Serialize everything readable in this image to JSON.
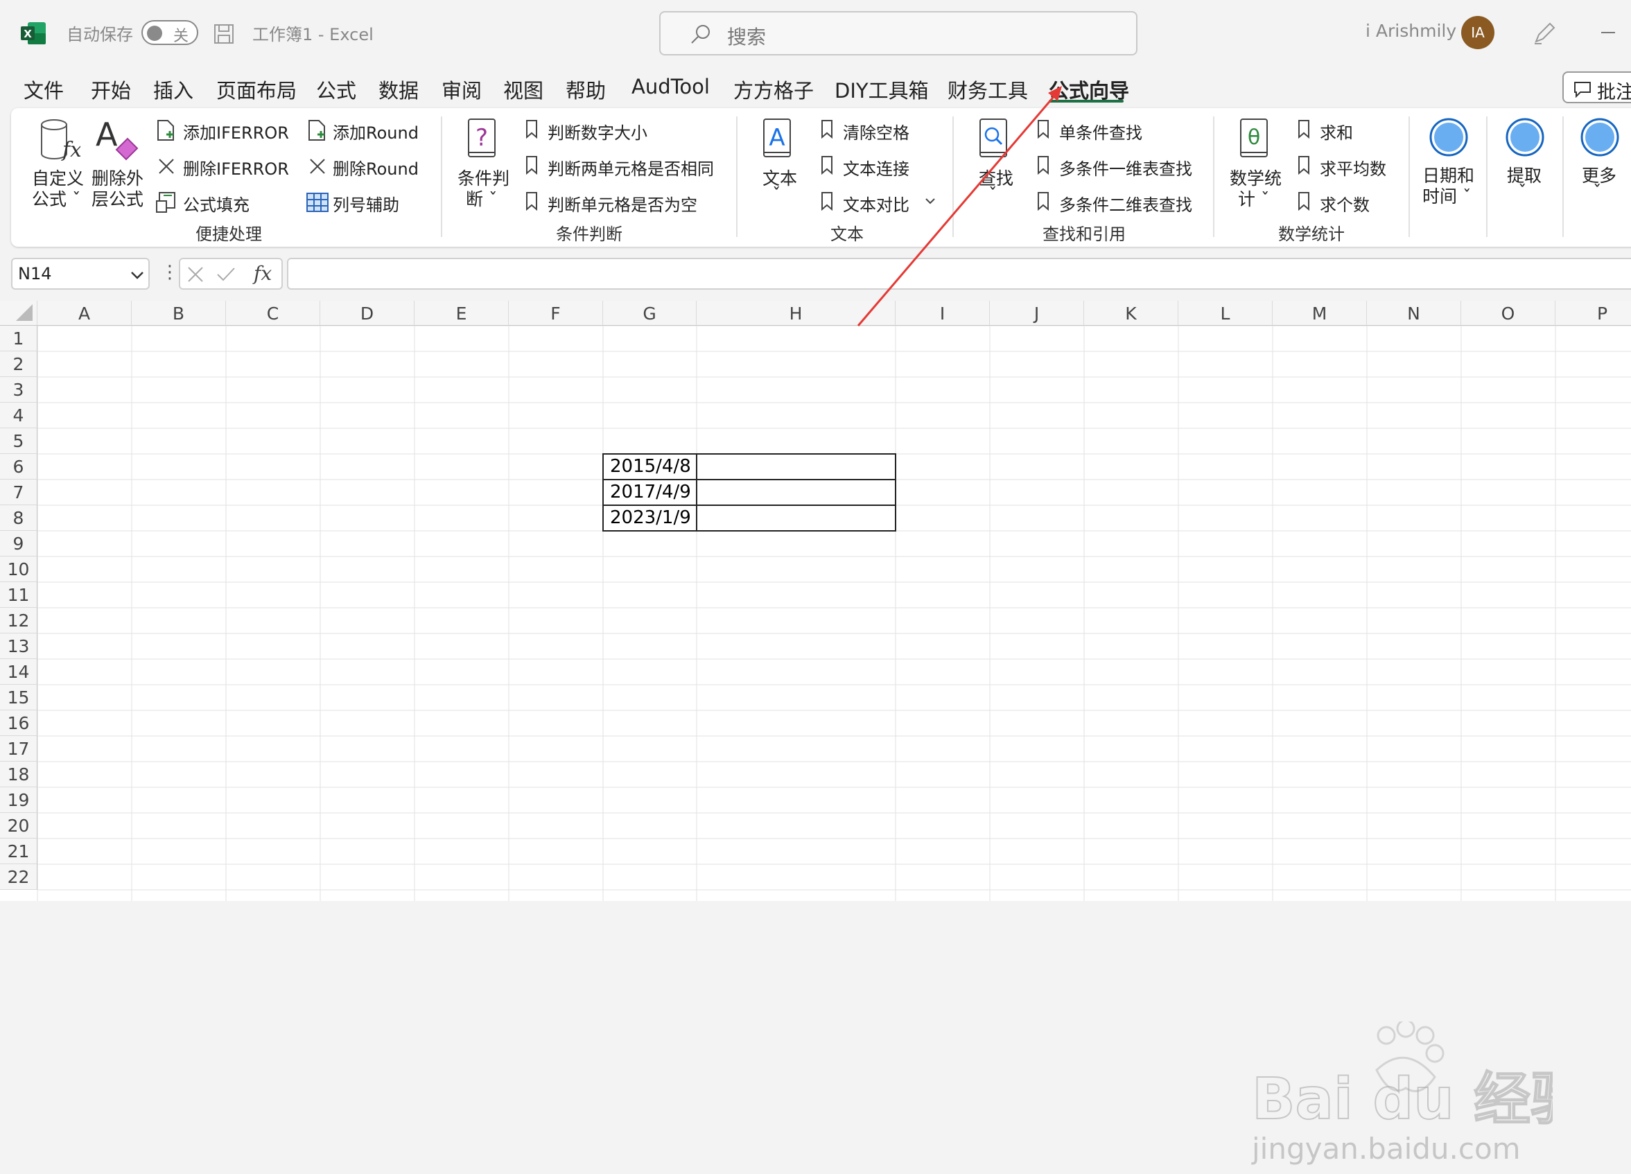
{
  "titlebar": {
    "autosave_label": "自动保存",
    "toggle_state": "关",
    "doc_title": "工作簿1  -  Excel",
    "search_placeholder": "搜索",
    "user_name": "i Arishmily",
    "avatar_initials": "IA"
  },
  "menu": {
    "items": [
      "文件",
      "开始",
      "插入",
      "页面布局",
      "公式",
      "数据",
      "审阅",
      "视图",
      "帮助",
      "AudTool",
      "方方格子",
      "DIY工具箱",
      "财务工具",
      "公式向导"
    ],
    "active": "公式向导",
    "comment_btn": "批注"
  },
  "ribbon": {
    "custom_formula": [
      "自定义",
      "公式 ˇ"
    ],
    "remove_outer": [
      "删除外",
      "层公式"
    ],
    "add_iferror": "添加IFERROR",
    "del_iferror": "删除IFERROR",
    "formula_fill": "公式填充",
    "add_round": "添加Round",
    "del_round": "删除Round",
    "col_helper": "列号辅助",
    "group_convenient": "便捷处理",
    "cond_judge": [
      "条件判",
      "断 ˇ"
    ],
    "judge_num_size": "判断数字大小",
    "judge_two_same": "判断两单元格是否相同",
    "judge_empty": "判断单元格是否为空",
    "group_cond": "条件判断",
    "text_btn": [
      "文本",
      "ˇ"
    ],
    "clear_space": "清除空格",
    "text_concat": "文本连接",
    "text_compare": "文本对比",
    "group_text": "文本",
    "lookup_btn": [
      "查找",
      "ˇ"
    ],
    "single_lookup": "单条件查找",
    "multi_1d": "多条件一维表查找",
    "multi_2d": "多条件二维表查找",
    "group_lookup": "查找和引用",
    "math_btn": [
      "数学统",
      "计 ˇ"
    ],
    "sum": "求和",
    "average": "求平均数",
    "count": "求个数",
    "group_math": "数学统计",
    "datetime": [
      "日期和",
      "时间 ˇ"
    ],
    "extract": [
      "提取",
      "ˇ"
    ],
    "more": [
      "更多",
      "ˇ"
    ]
  },
  "formula_bar": {
    "name_box": "N14",
    "fx_label": "fx"
  },
  "sheet": {
    "columns": [
      "A",
      "B",
      "C",
      "D",
      "E",
      "F",
      "G",
      "H",
      "I",
      "J",
      "K",
      "L",
      "M",
      "N",
      "O",
      "P"
    ],
    "rows": [
      "1",
      "2",
      "3",
      "4",
      "5",
      "6",
      "7",
      "8",
      "9",
      "10",
      "11",
      "12",
      "13",
      "14",
      "15",
      "16",
      "17",
      "18",
      "19",
      "20",
      "21",
      "22"
    ],
    "cells": {
      "G6": "2015/4/8",
      "G7": "2017/4/9",
      "G8": "2023/1/9"
    }
  },
  "watermark": {
    "brand": "Bai du 经验",
    "url": "jingyan.baidu.com"
  },
  "colors": {
    "excel_green": "#1e7145",
    "accent_blue": "#1a73e8",
    "annotation_red": "#e53935",
    "avatar": "#8a5a22"
  }
}
